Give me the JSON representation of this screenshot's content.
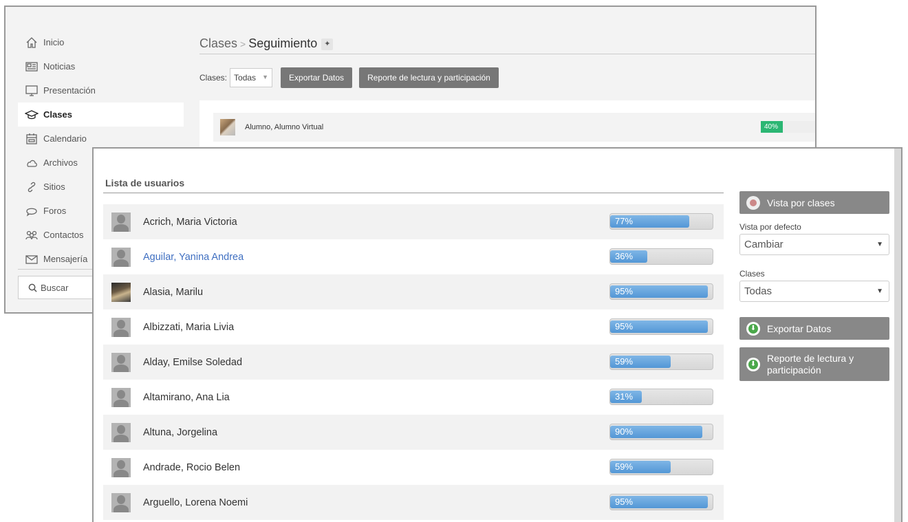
{
  "sidebar": {
    "items": [
      {
        "label": "Inicio",
        "icon": "home-icon"
      },
      {
        "label": "Noticias",
        "icon": "news-icon"
      },
      {
        "label": "Presentación",
        "icon": "monitor-icon"
      },
      {
        "label": "Clases",
        "icon": "graduation-cap-icon",
        "active": true
      },
      {
        "label": "Calendario",
        "icon": "calendar-icon"
      },
      {
        "label": "Archivos",
        "icon": "cloud-icon"
      },
      {
        "label": "Sitios",
        "icon": "link-icon"
      },
      {
        "label": "Foros",
        "icon": "chat-icon"
      },
      {
        "label": "Contactos",
        "icon": "contacts-icon"
      },
      {
        "label": "Mensajería",
        "icon": "envelope-icon"
      }
    ],
    "search_label": "Buscar"
  },
  "breadcrumb": {
    "parent": "Clases",
    "separator": ">",
    "current": "Seguimiento"
  },
  "filter": {
    "label": "Clases:",
    "value": "Todas"
  },
  "bg_toolbar": {
    "export_label": "Exportar Datos",
    "report_label": "Reporte de lectura y participación"
  },
  "bg_user": {
    "name": "Alumno, Alumno Virtual",
    "progress": 40,
    "progress_label": "40%"
  },
  "list": {
    "title": "Lista de usuarios",
    "users": [
      {
        "name": "Acrich, Maria Victoria",
        "progress": 77,
        "progress_label": "77%"
      },
      {
        "name": "Aguilar, Yanina Andrea",
        "progress": 36,
        "progress_label": "36%",
        "highlight": true
      },
      {
        "name": "Alasia, Marilu",
        "progress": 95,
        "progress_label": "95%",
        "photo": true
      },
      {
        "name": "Albizzati, Maria Livia",
        "progress": 95,
        "progress_label": "95%"
      },
      {
        "name": "Alday, Emilse Soledad",
        "progress": 59,
        "progress_label": "59%"
      },
      {
        "name": "Altamirano, Ana Lia",
        "progress": 31,
        "progress_label": "31%"
      },
      {
        "name": "Altuna, Jorgelina",
        "progress": 90,
        "progress_label": "90%"
      },
      {
        "name": "Andrade, Rocio Belen",
        "progress": 59,
        "progress_label": "59%"
      },
      {
        "name": "Arguello, Lorena Noemi",
        "progress": 95,
        "progress_label": "95%"
      }
    ]
  },
  "right_panel": {
    "vista_button": "Vista por clases",
    "default_view_label": "Vista por defecto",
    "default_view_value": "Cambiar",
    "classes_label": "Clases",
    "classes_value": "Todas",
    "export_button": "Exportar Datos",
    "report_button": "Reporte de lectura y participación"
  },
  "colors": {
    "accent_blue": "#5397d6",
    "green": "#2bb673",
    "button_gray": "#888888",
    "link": "#3f6fc1"
  }
}
